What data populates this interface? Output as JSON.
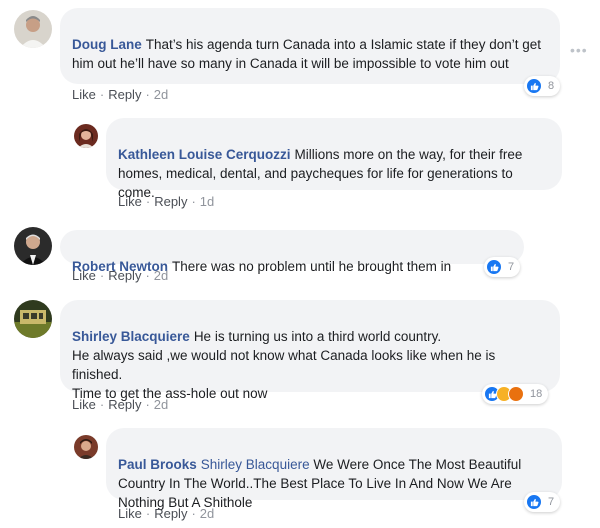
{
  "more_label": "•••",
  "actions": {
    "like": "Like",
    "reply": "Reply",
    "separator": "·"
  },
  "comments": [
    {
      "author": "Doug Lane",
      "text": "That’s his agenda turn Canada into a Islamic state if they don’t get him out he’ll have so many in Canada it will be impossible to vote him out",
      "time": "2d",
      "reactions": {
        "types": [
          "like"
        ],
        "count": "8"
      }
    },
    {
      "author": "Kathleen Louise Cerquozzi",
      "text": "Millions more on the way, for their free homes, medical, dental, and paycheques for life for generations to come.",
      "time": "1d",
      "reactions": null
    },
    {
      "author": "Robert Newton",
      "text": "There was no problem until he brought them in",
      "time": "2d",
      "reactions": {
        "types": [
          "like"
        ],
        "count": "7"
      }
    },
    {
      "author": "Shirley Blacquiere",
      "text": "He is turning us into a third world country.\nHe always said ,we would not know what Canada looks like when he is finished.\nTime to get the ass-hole out now",
      "time": "2d",
      "reactions": {
        "types": [
          "like",
          "haha",
          "angry"
        ],
        "count": "18"
      }
    },
    {
      "author": "Paul Brooks",
      "mention": "Shirley Blacquiere",
      "text": "We Were Once The Most Beautiful Country In The World..The Best Place To Live In And Now We Are Nothing But A Shithole",
      "time": "2d",
      "reactions": {
        "types": [
          "like"
        ],
        "count": "7"
      }
    }
  ],
  "colors": {
    "link": "#385898",
    "bubble": "#f2f3f5",
    "like_blue": "#1877f2",
    "haha_yellow": "#f7b125",
    "angry_orange": "#e9710f"
  }
}
